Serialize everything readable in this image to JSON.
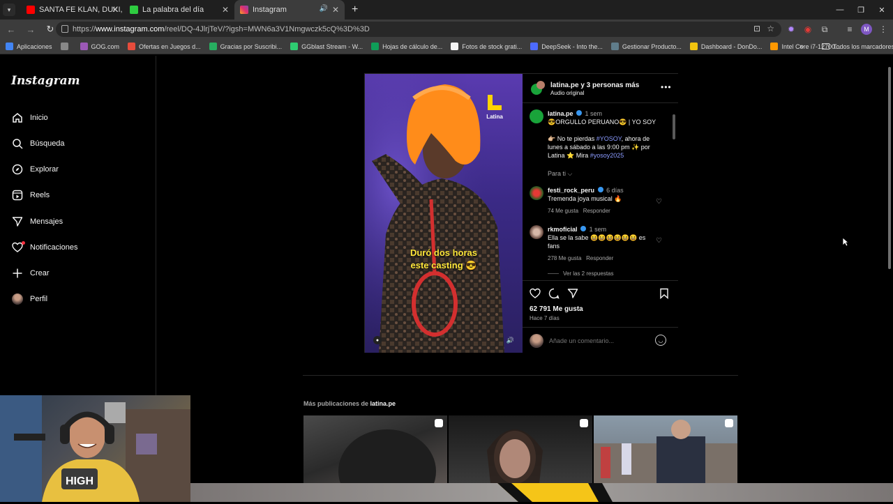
{
  "browser": {
    "tabs": [
      {
        "title": "SANTA FE KLAN, DUKI, PESO PL",
        "color": "#ff0000"
      },
      {
        "title": "La palabra del día",
        "color": "#2ecc40"
      },
      {
        "title": "Instagram",
        "color": "#e1306c"
      }
    ],
    "url_prefix": "https://",
    "url_domain": "www.instagram.com",
    "url_path": "/reel/DQ-4JlrjTeV/?igsh=MWN6a3V1Nmgwczk5cQ%3D%3D",
    "bookmarks": [
      {
        "label": "Aplicaciones",
        "color": "#4285f4"
      },
      {
        "label": "",
        "color": "#888888"
      },
      {
        "label": "GOG.com",
        "color": "#9b59b6"
      },
      {
        "label": "Ofertas en Juegos d...",
        "color": "#e74c3c"
      },
      {
        "label": "Gracias por Suscribi...",
        "color": "#27ae60"
      },
      {
        "label": "GGblast Stream - W...",
        "color": "#2ecc71"
      },
      {
        "label": "Hojas de cálculo de...",
        "color": "#0f9d58"
      },
      {
        "label": "Fotos de stock grati...",
        "color": "#f5f5f5"
      },
      {
        "label": "DeepSeek - Into the...",
        "color": "#4d6bfe"
      },
      {
        "label": "Gestionar Producto...",
        "color": "#607d8b"
      },
      {
        "label": "Dashboard - DonDo...",
        "color": "#f1c40f"
      },
      {
        "label": "Intel Core i7-12700...",
        "color": "#ff9800"
      }
    ],
    "all_bookmarks": "Todos los marcadores",
    "profile_initial": "M"
  },
  "sidebar": {
    "logo": "Instagram",
    "items": [
      {
        "label": "Inicio",
        "icon": "home-icon"
      },
      {
        "label": "Búsqueda",
        "icon": "search-icon"
      },
      {
        "label": "Explorar",
        "icon": "explore-icon"
      },
      {
        "label": "Reels",
        "icon": "reels-icon"
      },
      {
        "label": "Mensajes",
        "icon": "messages-icon"
      },
      {
        "label": "Notificaciones",
        "icon": "heart-icon"
      },
      {
        "label": "Crear",
        "icon": "plus-icon"
      },
      {
        "label": "Perfil",
        "icon": "profile-avatar"
      }
    ]
  },
  "post": {
    "overlay_line1": "Duró dos horas",
    "overlay_line2": "este casting 😎",
    "brand": "Latina",
    "header_title": "latina.pe y 3 personas más",
    "header_subtitle": "Audio original",
    "caption": {
      "user": "latina.pe",
      "time": "1 sem",
      "line1": "😎ORGULLO PERUANO😎 | YO SOY",
      "line2a": "👉🏼 No te pierdas",
      "hashtag1": "#YOSOY",
      "line2b": ", ahora de",
      "line3": "lunes a sábado a las 9:00 pm ✨ por",
      "line4a": "Latina ⭐ Mira",
      "hashtag2": "#yosoy2025",
      "see_translation": "Para ti"
    },
    "comments": [
      {
        "user": "festi_rock_peru",
        "time": "6 días",
        "text": "Tremenda joya musical 🔥",
        "likes": "74 Me gusta",
        "reply": "Responder"
      },
      {
        "user": "rkmoficial",
        "time": "1 sem",
        "text1": "Ella se la sabe 😆😆😆😆😆😆 es",
        "text2": "fans",
        "likes": "278 Me gusta",
        "reply": "Responder",
        "view_replies": "Ver las 2 respuestas"
      }
    ],
    "likes": "62 791 Me gusta",
    "posted": "Hace 7 días",
    "comment_placeholder": "Añade un comentario..."
  },
  "more": {
    "prefix": "Más publicaciones de ",
    "user": "latina.pe"
  }
}
